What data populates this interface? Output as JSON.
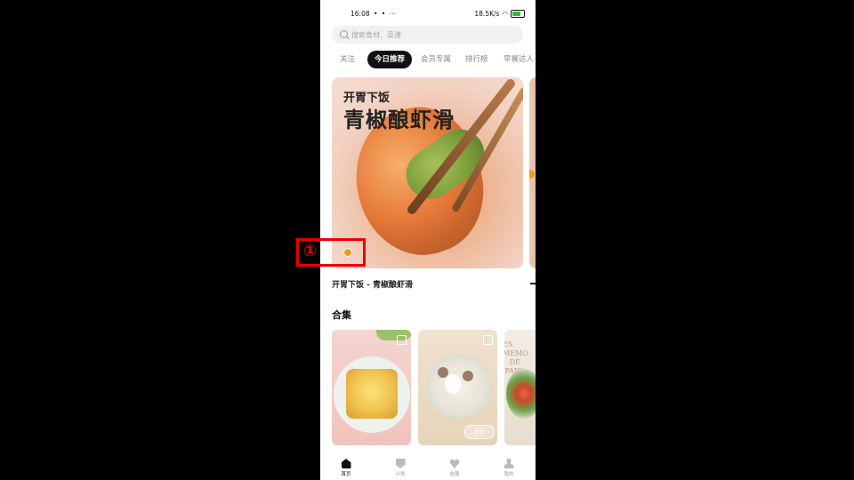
{
  "status_bar": {
    "time": "16:08",
    "dots": "• • ⋯",
    "network_speed": "18.5K/s"
  },
  "search": {
    "placeholder": "搜索食材、菜谱"
  },
  "tabs": [
    {
      "label": "关注",
      "active": false
    },
    {
      "label": "今日推荐",
      "active": true
    },
    {
      "label": "会员专属",
      "active": false
    },
    {
      "label": "排行榜",
      "active": false
    },
    {
      "label": "早餐达人",
      "active": false
    }
  ],
  "banner": {
    "title_small": "开胃下饭",
    "title_large": "青椒酿虾滑",
    "caption": "开胃下饭 - 青椒酿虾滑"
  },
  "annotation": {
    "number": "①"
  },
  "section": {
    "title": "合集"
  },
  "collections": [
    {
      "name": "collection-pizza-tart",
      "tag": ""
    },
    {
      "name": "collection-soup-bowl",
      "tag": "汤水"
    },
    {
      "name": "collection-salad",
      "script_text": "ES MEMO\nDE\nPAJO"
    }
  ],
  "bottom_nav": [
    {
      "label": "首页",
      "icon": "home-icon",
      "active": true
    },
    {
      "label": "计划",
      "icon": "plan-shield-icon",
      "active": false
    },
    {
      "label": "收藏",
      "icon": "heart-icon",
      "active": false
    },
    {
      "label": "我的",
      "icon": "user-icon",
      "active": false
    }
  ],
  "colors": {
    "accent": "#f39a1e",
    "annotation_red": "#e00000",
    "active_tab_bg": "#111111"
  }
}
